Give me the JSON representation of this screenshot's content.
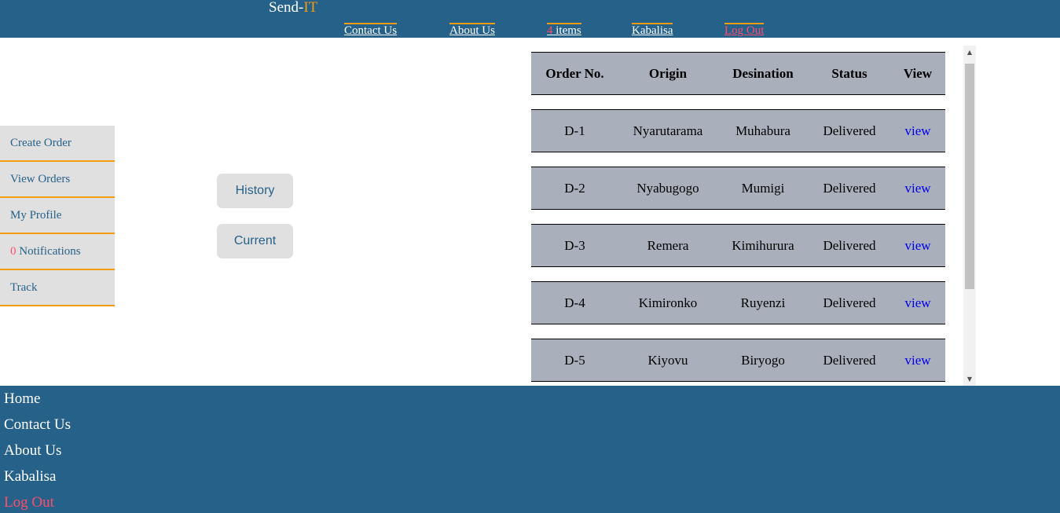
{
  "header": {
    "brand_main": "Send-",
    "brand_accent": "IT",
    "nav": {
      "contact": "Contact Us",
      "about": "About Us",
      "cart_count": "4",
      "cart_label": " items",
      "user": "Kabalisa",
      "logout": "Log Out"
    }
  },
  "sidebar": {
    "create_order": "Create Order",
    "view_orders": "View Orders",
    "my_profile": "My Profile",
    "notifications_count": "0",
    "notifications_label": " Notifications",
    "track": "Track"
  },
  "buttons": {
    "history": "History",
    "current": "Current"
  },
  "table": {
    "headers": [
      "Order No.",
      "Origin",
      "Desination",
      "Status",
      "View"
    ],
    "rows": [
      {
        "order": "D-1",
        "origin": "Nyarutarama",
        "destination": "Muhabura",
        "status": "Delivered",
        "view": "view"
      },
      {
        "order": "D-2",
        "origin": "Nyabugogo",
        "destination": "Mumigi",
        "status": "Delivered",
        "view": "view"
      },
      {
        "order": "D-3",
        "origin": "Remera",
        "destination": "Kimihurura",
        "status": "Delivered",
        "view": "view"
      },
      {
        "order": "D-4",
        "origin": "Kimironko",
        "destination": "Ruyenzi",
        "status": "Delivered",
        "view": "view"
      },
      {
        "order": "D-5",
        "origin": "Kiyovu",
        "destination": "Biryogo",
        "status": "Delivered",
        "view": "view"
      }
    ]
  },
  "footer": {
    "home": "Home",
    "contact": "Contact Us",
    "about": "About Us",
    "user": "Kabalisa",
    "logout": "Log Out"
  },
  "icons": {
    "scroll_up": "triangle-up-icon",
    "scroll_down": "triangle-down-icon"
  },
  "colors": {
    "primary": "#266189",
    "accent": "#f39c12",
    "alert": "#ff4d6d",
    "row_bg": "#a9b0bb",
    "link": "#0000ee"
  }
}
